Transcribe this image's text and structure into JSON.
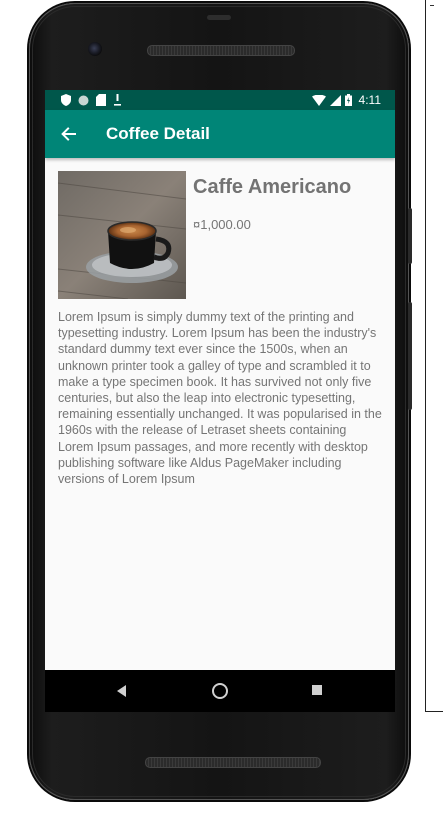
{
  "status_bar": {
    "time": "4:11",
    "left_icons": [
      "shield-icon",
      "circle-icon",
      "sd-card-icon",
      "download-icon"
    ],
    "right_icons": [
      "wifi-icon",
      "signal-icon",
      "battery-icon"
    ]
  },
  "app_bar": {
    "back_icon": "arrow-back-icon",
    "title": "Coffee Detail"
  },
  "product": {
    "image": "coffee-cup-image",
    "name": "Caffe Americano",
    "price": "¤1,000.00",
    "description": "Lorem Ipsum is simply dummy text of the printing and typesetting industry. Lorem Ipsum has been the industry's standard dummy text ever since the 1500s, when an unknown printer took a galley of type and scrambled it to make a type specimen book. It has survived not only five centuries, but also the leap into electronic typesetting, remaining essentially unchanged. It was popularised in the 1960s with the release of Letraset sheets containing Lorem Ipsum passages, and more recently with desktop publishing software like Aldus PageMaker including versions of Lorem Ipsum"
  },
  "nav_bar": {
    "buttons": [
      "back-triangle-icon",
      "home-circle-icon",
      "recents-square-icon"
    ]
  },
  "colors": {
    "status_bar": "#00574b",
    "app_bar": "#008577",
    "screen_background": "#fafafa",
    "title_text": "#737373",
    "body_text": "#757575"
  }
}
